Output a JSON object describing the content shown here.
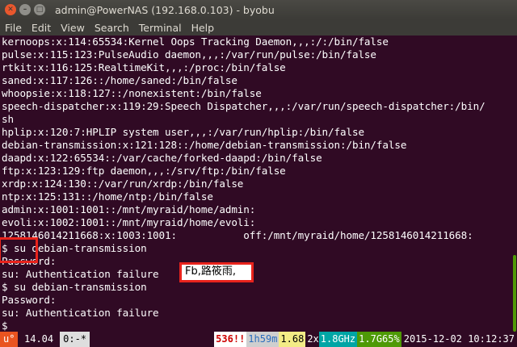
{
  "window": {
    "title": "admin@PowerNAS (192.168.0.103) - byobu",
    "close_glyph": "✕",
    "min_glyph": "–",
    "max_glyph": "□"
  },
  "menu": [
    "File",
    "Edit",
    "View",
    "Search",
    "Terminal",
    "Help"
  ],
  "terminal_lines": [
    "kernoops:x:114:65534:Kernel Oops Tracking Daemon,,,:/:/bin/false",
    "pulse:x:115:123:PulseAudio daemon,,,:/var/run/pulse:/bin/false",
    "rtkit:x:116:125:RealtimeKit,,,:/proc:/bin/false",
    "saned:x:117:126::/home/saned:/bin/false",
    "whoopsie:x:118:127::/nonexistent:/bin/false",
    "speech-dispatcher:x:119:29:Speech Dispatcher,,,:/var/run/speech-dispatcher:/bin/",
    "sh",
    "hplip:x:120:7:HPLIP system user,,,:/var/run/hplip:/bin/false",
    "debian-transmission:x:121:128::/home/debian-transmission:/bin/false",
    "daapd:x:122:65534::/var/cache/forked-daapd:/bin/false",
    "ftp:x:123:129:ftp daemon,,,:/srv/ftp:/bin/false",
    "xrdp:x:124:130::/var/run/xrdp:/bin/false",
    "ntp:x:125:131::/home/ntp:/bin/false",
    "admin:x:1001:1001::/mnt/myraid/home/admin:",
    "evoli:x:1002:1001::/mnt/myraid/home/evoli:",
    "1258146014211668:x:1003:1001:           off:/mnt/myraid/home/1258146014211668:",
    "$ su debian-transmission",
    "Password:",
    "su: Authentication failure",
    "$ su debian-transmission",
    "Password:",
    "su: Authentication failure",
    "$ "
  ],
  "highlight_name": "Fb,路筱雨,",
  "statusbar": {
    "logo": "u°",
    "version": "14.04",
    "window": "0:-*",
    "updates": "536!!",
    "uptime": "1h59m",
    "load": "1.68",
    "cpu_count": "2x",
    "cpu_freq": "1.8GHz",
    "memory": "1.7G65%",
    "datetime": "2015-12-02 10:12:37"
  },
  "colors": {
    "terminal_bg": "#300a24",
    "highlight_border": "#e8231c",
    "ubuntu_orange": "#e95420"
  }
}
